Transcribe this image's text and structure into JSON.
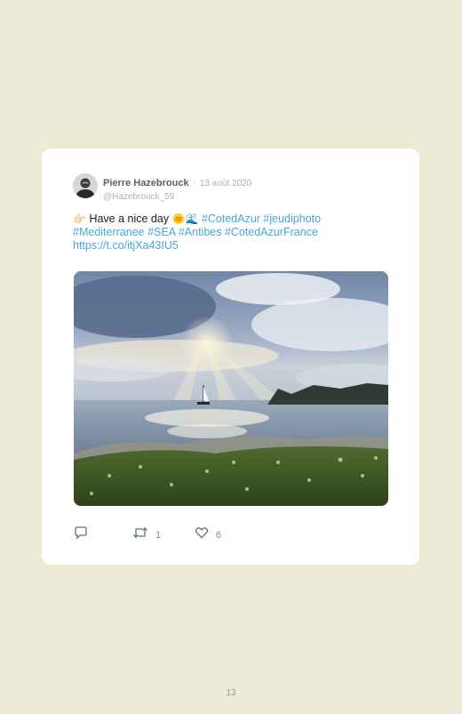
{
  "tweet": {
    "author_name": "Pierre Hazebrouck",
    "separator": "·",
    "date": "13 août 2020",
    "handle": "@Hazebrouck_59",
    "emoji_pointing": "👉🏻",
    "text": "Have a nice day",
    "emoji_sun_wave": "🌞🌊",
    "hashtags_line1": "#CotedAzur #jeudiphoto",
    "hashtags_line2": "#Mediterranee #SEA #Antibes #CotedAzurFrance",
    "link": "https://t.co/itjXa43IU5",
    "retweet_count": "1",
    "like_count": "6"
  },
  "icons": {
    "reply": "reply-icon",
    "retweet": "retweet-icon",
    "like": "heart-icon"
  },
  "colors": {
    "page_background": "#edead6",
    "card_background": "#ffffff",
    "link": "#48a6dd",
    "muted": "#a9b2ba"
  },
  "page": {
    "number": "13"
  }
}
